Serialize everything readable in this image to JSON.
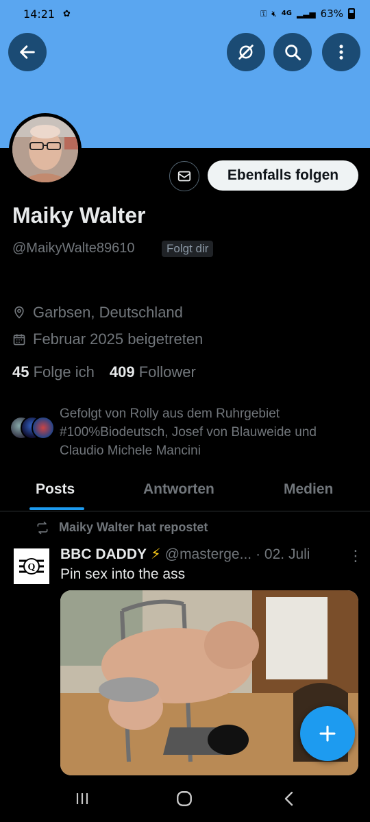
{
  "status_bar": {
    "time": "14:21",
    "network": "4G",
    "battery": "63%"
  },
  "colors": {
    "banner": "#5aa6f0",
    "accent": "#1d9bf0",
    "button_bg": "#1b4b74"
  },
  "header": {
    "back_icon": "arrow-left-icon",
    "grok_icon": "grok-icon",
    "search_icon": "search-icon",
    "more_icon": "more-vertical-icon"
  },
  "profile": {
    "name": "Maiky Walter",
    "handle": "@MaikyWalte89610",
    "follows_you": "Folgt dir",
    "follow_button": "Ebenfalls folgen",
    "location": "Garbsen, Deutschland",
    "joined": "Februar 2025 beigetreten",
    "following_count": "45",
    "following_label": "Folge ich",
    "followers_count": "409",
    "followers_label": "Follower",
    "followed_by": "Gefolgt von Rolly aus dem Ruhrgebiet #100%Biodeutsch, Josef von Blauweide und Claudio Michele Mancini"
  },
  "tabs": [
    {
      "label": "Posts",
      "active": true
    },
    {
      "label": "Antworten",
      "active": false
    },
    {
      "label": "Medien",
      "active": false
    }
  ],
  "post": {
    "repost_label": "Maiky Walter hat repostet",
    "author_name": "BBC DADDY",
    "author_emoji": "⚡",
    "author_handle": "@masterge...",
    "date": "· 02. Juli",
    "text": "Pin sex into the ass"
  }
}
